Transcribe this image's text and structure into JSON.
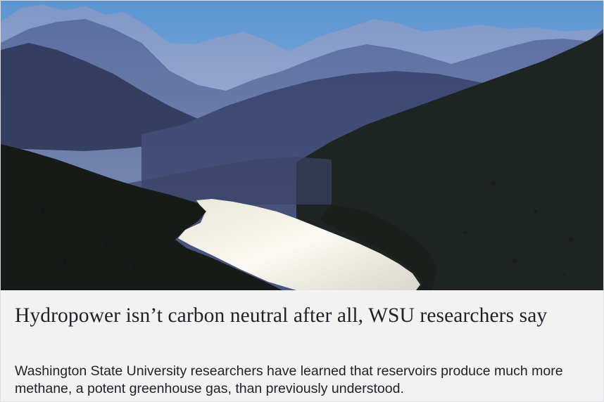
{
  "link_preview": {
    "image_alt": "Mountain valley with a bright reservoir lake",
    "headline": "Hydropower isn’t carbon neutral after all, WSU researchers say",
    "description": "Washington State University researchers have learned that reservoirs produce much more methane, a potent greenhouse gas, than previously understood.",
    "colors": {
      "background": "#f2f2f2",
      "text": "#1d2129",
      "sky_top": "#5b95d1",
      "sky_bottom": "#a9c3e2",
      "mountains_far": "#8ea3cc",
      "mountains_dark": "#1b1f1c",
      "water": "#f0eee4"
    }
  }
}
